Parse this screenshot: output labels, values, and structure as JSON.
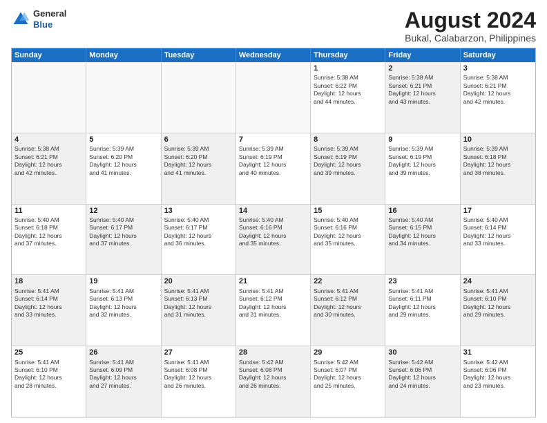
{
  "header": {
    "logo_general": "General",
    "logo_blue": "Blue",
    "title": "August 2024",
    "subtitle": "Bukal, Calabarzon, Philippines"
  },
  "calendar": {
    "weekdays": [
      "Sunday",
      "Monday",
      "Tuesday",
      "Wednesday",
      "Thursday",
      "Friday",
      "Saturday"
    ],
    "rows": [
      [
        {
          "day": "",
          "text": "",
          "empty": true
        },
        {
          "day": "",
          "text": "",
          "empty": true
        },
        {
          "day": "",
          "text": "",
          "empty": true
        },
        {
          "day": "",
          "text": "",
          "empty": true
        },
        {
          "day": "1",
          "text": "Sunrise: 5:38 AM\nSunset: 6:22 PM\nDaylight: 12 hours\nand 44 minutes.",
          "empty": false,
          "shaded": false
        },
        {
          "day": "2",
          "text": "Sunrise: 5:38 AM\nSunset: 6:21 PM\nDaylight: 12 hours\nand 43 minutes.",
          "empty": false,
          "shaded": true
        },
        {
          "day": "3",
          "text": "Sunrise: 5:38 AM\nSunset: 6:21 PM\nDaylight: 12 hours\nand 42 minutes.",
          "empty": false,
          "shaded": false
        }
      ],
      [
        {
          "day": "4",
          "text": "Sunrise: 5:38 AM\nSunset: 6:21 PM\nDaylight: 12 hours\nand 42 minutes.",
          "empty": false,
          "shaded": true
        },
        {
          "day": "5",
          "text": "Sunrise: 5:39 AM\nSunset: 6:20 PM\nDaylight: 12 hours\nand 41 minutes.",
          "empty": false,
          "shaded": false
        },
        {
          "day": "6",
          "text": "Sunrise: 5:39 AM\nSunset: 6:20 PM\nDaylight: 12 hours\nand 41 minutes.",
          "empty": false,
          "shaded": true
        },
        {
          "day": "7",
          "text": "Sunrise: 5:39 AM\nSunset: 6:19 PM\nDaylight: 12 hours\nand 40 minutes.",
          "empty": false,
          "shaded": false
        },
        {
          "day": "8",
          "text": "Sunrise: 5:39 AM\nSunset: 6:19 PM\nDaylight: 12 hours\nand 39 minutes.",
          "empty": false,
          "shaded": true
        },
        {
          "day": "9",
          "text": "Sunrise: 5:39 AM\nSunset: 6:19 PM\nDaylight: 12 hours\nand 39 minutes.",
          "empty": false,
          "shaded": false
        },
        {
          "day": "10",
          "text": "Sunrise: 5:39 AM\nSunset: 6:18 PM\nDaylight: 12 hours\nand 38 minutes.",
          "empty": false,
          "shaded": true
        }
      ],
      [
        {
          "day": "11",
          "text": "Sunrise: 5:40 AM\nSunset: 6:18 PM\nDaylight: 12 hours\nand 37 minutes.",
          "empty": false,
          "shaded": false
        },
        {
          "day": "12",
          "text": "Sunrise: 5:40 AM\nSunset: 6:17 PM\nDaylight: 12 hours\nand 37 minutes.",
          "empty": false,
          "shaded": true
        },
        {
          "day": "13",
          "text": "Sunrise: 5:40 AM\nSunset: 6:17 PM\nDaylight: 12 hours\nand 36 minutes.",
          "empty": false,
          "shaded": false
        },
        {
          "day": "14",
          "text": "Sunrise: 5:40 AM\nSunset: 6:16 PM\nDaylight: 12 hours\nand 35 minutes.",
          "empty": false,
          "shaded": true
        },
        {
          "day": "15",
          "text": "Sunrise: 5:40 AM\nSunset: 6:16 PM\nDaylight: 12 hours\nand 35 minutes.",
          "empty": false,
          "shaded": false
        },
        {
          "day": "16",
          "text": "Sunrise: 5:40 AM\nSunset: 6:15 PM\nDaylight: 12 hours\nand 34 minutes.",
          "empty": false,
          "shaded": true
        },
        {
          "day": "17",
          "text": "Sunrise: 5:40 AM\nSunset: 6:14 PM\nDaylight: 12 hours\nand 33 minutes.",
          "empty": false,
          "shaded": false
        }
      ],
      [
        {
          "day": "18",
          "text": "Sunrise: 5:41 AM\nSunset: 6:14 PM\nDaylight: 12 hours\nand 33 minutes.",
          "empty": false,
          "shaded": true
        },
        {
          "day": "19",
          "text": "Sunrise: 5:41 AM\nSunset: 6:13 PM\nDaylight: 12 hours\nand 32 minutes.",
          "empty": false,
          "shaded": false
        },
        {
          "day": "20",
          "text": "Sunrise: 5:41 AM\nSunset: 6:13 PM\nDaylight: 12 hours\nand 31 minutes.",
          "empty": false,
          "shaded": true
        },
        {
          "day": "21",
          "text": "Sunrise: 5:41 AM\nSunset: 6:12 PM\nDaylight: 12 hours\nand 31 minutes.",
          "empty": false,
          "shaded": false
        },
        {
          "day": "22",
          "text": "Sunrise: 5:41 AM\nSunset: 6:12 PM\nDaylight: 12 hours\nand 30 minutes.",
          "empty": false,
          "shaded": true
        },
        {
          "day": "23",
          "text": "Sunrise: 5:41 AM\nSunset: 6:11 PM\nDaylight: 12 hours\nand 29 minutes.",
          "empty": false,
          "shaded": false
        },
        {
          "day": "24",
          "text": "Sunrise: 5:41 AM\nSunset: 6:10 PM\nDaylight: 12 hours\nand 29 minutes.",
          "empty": false,
          "shaded": true
        }
      ],
      [
        {
          "day": "25",
          "text": "Sunrise: 5:41 AM\nSunset: 6:10 PM\nDaylight: 12 hours\nand 28 minutes.",
          "empty": false,
          "shaded": false
        },
        {
          "day": "26",
          "text": "Sunrise: 5:41 AM\nSunset: 6:09 PM\nDaylight: 12 hours\nand 27 minutes.",
          "empty": false,
          "shaded": true
        },
        {
          "day": "27",
          "text": "Sunrise: 5:41 AM\nSunset: 6:08 PM\nDaylight: 12 hours\nand 26 minutes.",
          "empty": false,
          "shaded": false
        },
        {
          "day": "28",
          "text": "Sunrise: 5:42 AM\nSunset: 6:08 PM\nDaylight: 12 hours\nand 26 minutes.",
          "empty": false,
          "shaded": true
        },
        {
          "day": "29",
          "text": "Sunrise: 5:42 AM\nSunset: 6:07 PM\nDaylight: 12 hours\nand 25 minutes.",
          "empty": false,
          "shaded": false
        },
        {
          "day": "30",
          "text": "Sunrise: 5:42 AM\nSunset: 6:06 PM\nDaylight: 12 hours\nand 24 minutes.",
          "empty": false,
          "shaded": true
        },
        {
          "day": "31",
          "text": "Sunrise: 5:42 AM\nSunset: 6:06 PM\nDaylight: 12 hours\nand 23 minutes.",
          "empty": false,
          "shaded": false
        }
      ]
    ]
  }
}
